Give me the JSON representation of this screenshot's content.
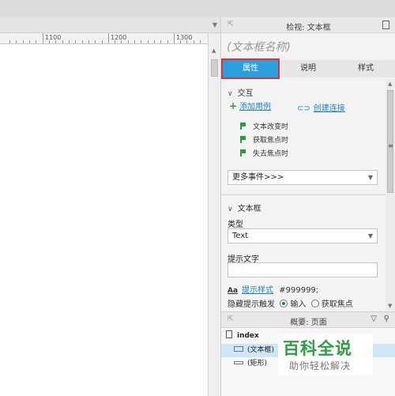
{
  "ruler": {
    "ticks": [
      "1100",
      "1200",
      "1300"
    ]
  },
  "inspector": {
    "title": "检视: 文本框",
    "widget_name_placeholder": "(文本框名称)",
    "tabs": [
      {
        "label": "属性",
        "active": true
      },
      {
        "label": "说明",
        "active": false
      },
      {
        "label": "样式",
        "active": false
      }
    ],
    "interaction": {
      "heading": "交互",
      "add_case": "添加用例",
      "create_link": "创建连接",
      "events": [
        "文本改变时",
        "获取焦点时",
        "失去焦点时"
      ],
      "more_events": "更多事件>>>"
    },
    "textbox_section": {
      "heading": "文本框",
      "type_label": "类型",
      "type_value": "Text",
      "hint_label": "提示文字",
      "hint_value": "",
      "hint_style_prefix": "Aa",
      "hint_style_link": "提示样式",
      "hint_color": "#999999;",
      "hide_hint_label": "隐藏提示触发",
      "option_input": "输入",
      "option_focus": "获取焦点"
    },
    "accent_color": "#2a9fdb"
  },
  "outline": {
    "title": "概要: 页面",
    "items": [
      {
        "label": "index",
        "icon": "document-icon"
      },
      {
        "label": "(文本框)",
        "icon": "textbox-icon",
        "selected": true
      },
      {
        "label": "(矩形)",
        "icon": "rectangle-icon"
      }
    ]
  },
  "watermark": {
    "main": "百科全说",
    "sub": "助你轻松解决"
  }
}
